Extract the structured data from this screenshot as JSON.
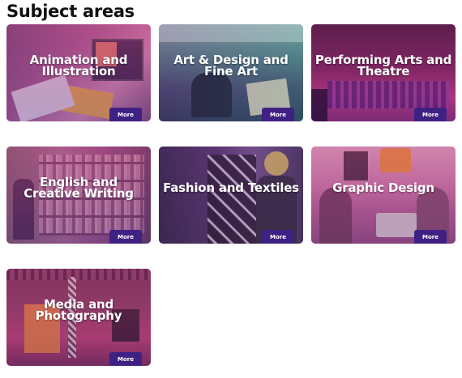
{
  "page": {
    "heading": "Subject areas"
  },
  "colors": {
    "button": "#3f2183",
    "tint_pink": "#c2418a",
    "tint_purple": "#5b2a86"
  },
  "cards": [
    {
      "title": "Animation and Illustration",
      "button": "More"
    },
    {
      "title": "Art & Design and Fine Art",
      "button": "More"
    },
    {
      "title": "Performing Arts and Theatre",
      "button": "More"
    },
    {
      "title": "English and Creative Writing",
      "button": "More"
    },
    {
      "title": "Fashion and Textiles",
      "button": "More"
    },
    {
      "title": "Graphic Design",
      "button": "More"
    },
    {
      "title": "Media and Photography",
      "button": "More"
    }
  ]
}
